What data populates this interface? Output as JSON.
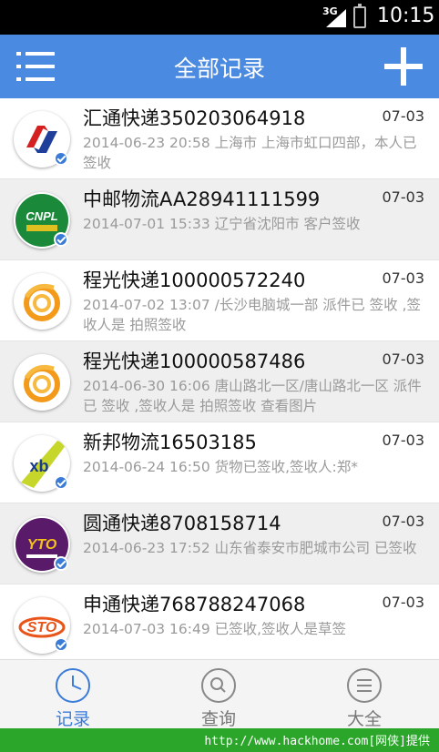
{
  "status_bar": {
    "network": "3G",
    "time": "10:15"
  },
  "header": {
    "title": "全部记录"
  },
  "records": [
    {
      "name": "汇通快递350203064918",
      "date": "07-03",
      "detail": "2014-06-23 20:58 上海市 上海市虹口四部，本人已签收",
      "logo": "huitong-logo",
      "verified": true
    },
    {
      "name": "中邮物流AA28941111599",
      "date": "07-03",
      "detail": "2014-07-01 15:33 辽宁省沈阳市 客户签收",
      "logo": "cnpl-logo",
      "verified": true
    },
    {
      "name": "程光快递100000572240",
      "date": "07-03",
      "detail": "2014-07-02 13:07 /长沙电脑城一部 派件已 签收 ,签收人是 拍照签收",
      "logo": "chengguang-logo",
      "verified": false
    },
    {
      "name": "程光快递100000587486",
      "date": "07-03",
      "detail": "2014-06-30 16:06 唐山路北一区/唐山路北一区 派件已 签收 ,签收人是 拍照签收 查看图片",
      "logo": "chengguang-logo",
      "verified": false
    },
    {
      "name": "新邦物流16503185",
      "date": "07-03",
      "detail": "2014-06-24 16:50 货物已签收,签收人:郑*",
      "logo": "xinbang-logo",
      "verified": true
    },
    {
      "name": "圆通快递8708158714",
      "date": "07-03",
      "detail": "2014-06-23 17:52 山东省泰安市肥城市公司 已签收",
      "logo": "yuantong-logo",
      "verified": true
    },
    {
      "name": "申通快递768788247068",
      "date": "07-03",
      "detail": "2014-07-03 16:49 已签收,签收人是草签",
      "logo": "shentong-logo",
      "verified": true
    }
  ],
  "logo_text": {
    "cnpl": "CNPL",
    "xinbang": "xb",
    "yuantong": "YTO",
    "shentong": "STO"
  },
  "bottom_nav": [
    {
      "label": "记录",
      "icon": "clock-icon",
      "active": true
    },
    {
      "label": "查询",
      "icon": "search-icon",
      "active": false
    },
    {
      "label": "大全",
      "icon": "list-icon",
      "active": false
    }
  ],
  "footer": {
    "watermark": "http://www.hackhome.com[网侠]提供"
  },
  "colors": {
    "header": "#4a8ae0",
    "accent": "#3b7bd8",
    "footer": "#2ba62b"
  }
}
